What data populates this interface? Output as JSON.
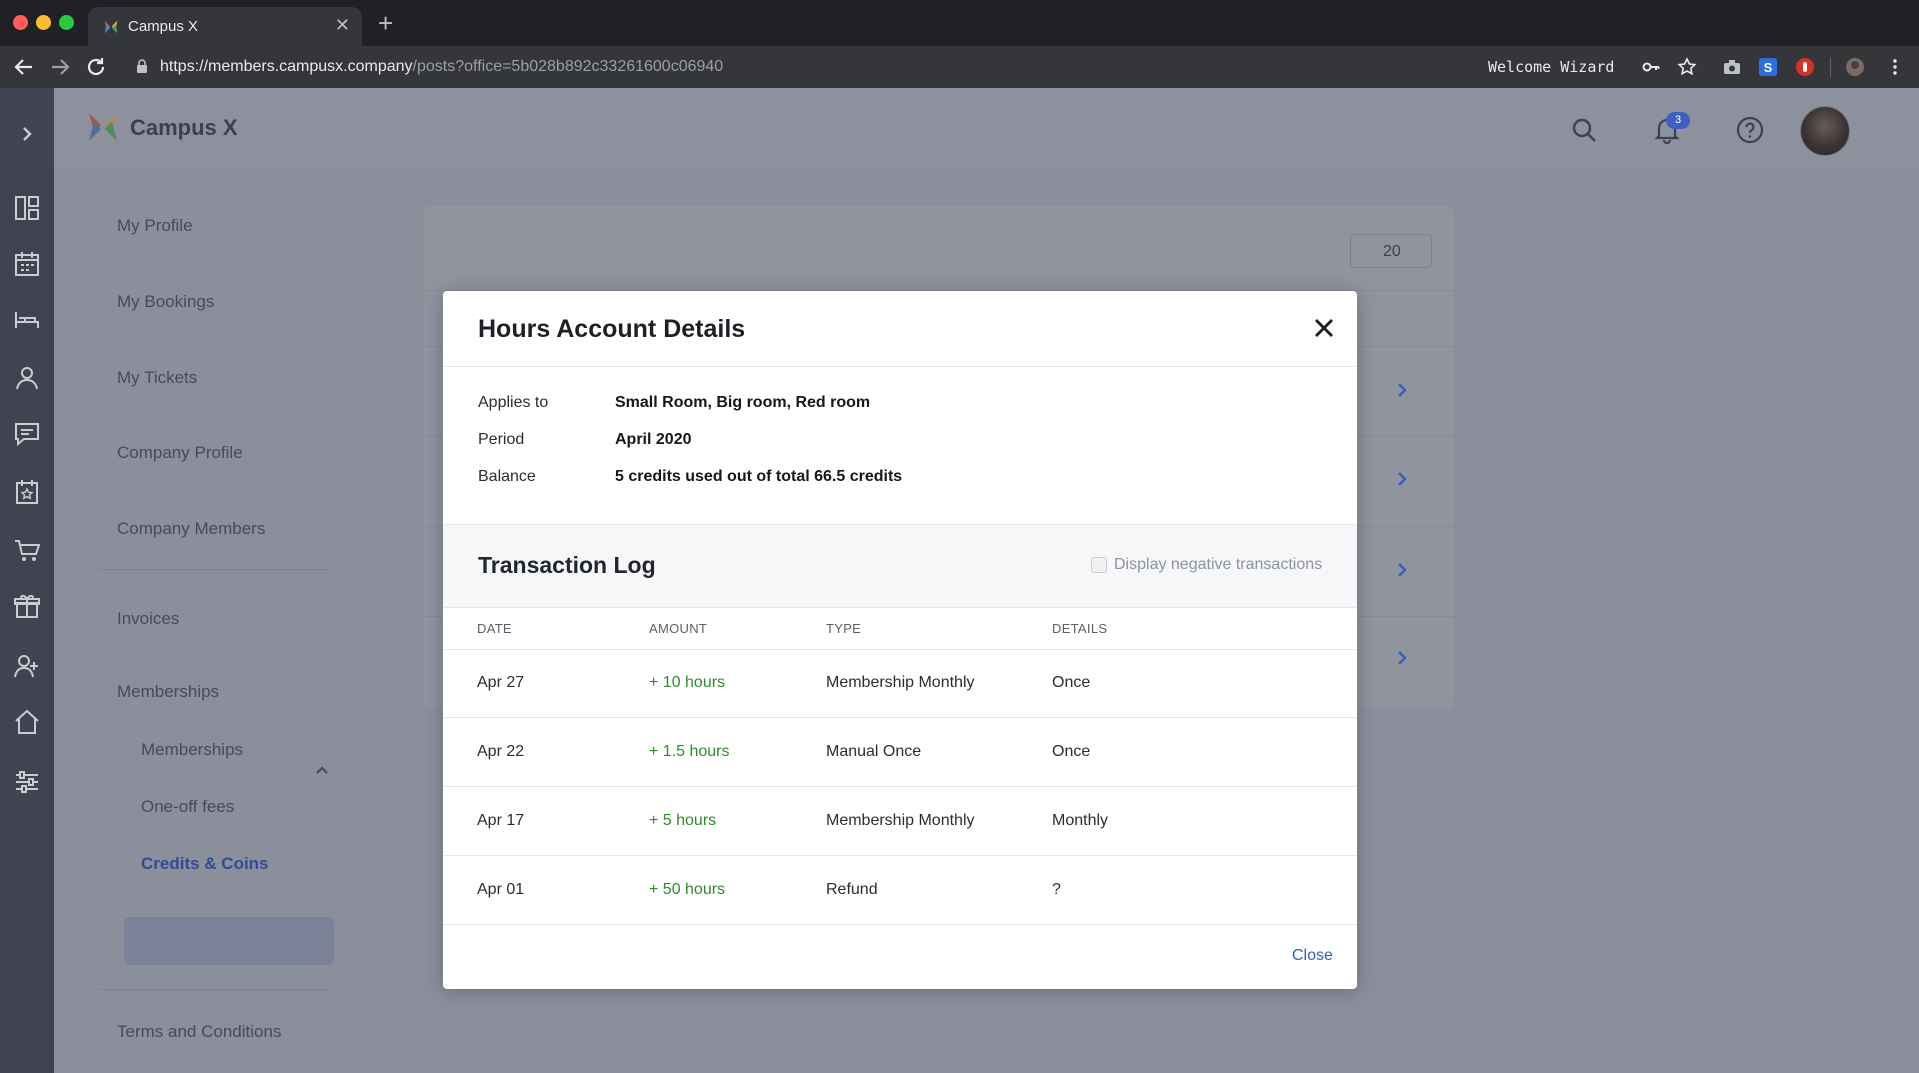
{
  "browser": {
    "tab_title": "Campus X",
    "url_host": "https://members.campusx.company",
    "url_path": "/posts?office=5b028b892c33261600c06940",
    "profile_name": "Welcome Wizard"
  },
  "app": {
    "brand": "Campus X",
    "notification_count": "3"
  },
  "sidebar": {
    "items": [
      {
        "label": "My Profile"
      },
      {
        "label": "My Bookings"
      },
      {
        "label": "My Tickets"
      },
      {
        "label": "Company Profile"
      },
      {
        "label": "Company Members"
      },
      {
        "label": "Invoices"
      },
      {
        "label": "Memberships"
      },
      {
        "label": "Terms and Conditions"
      }
    ],
    "sub_items": [
      {
        "label": "Memberships"
      },
      {
        "label": "One-off fees"
      },
      {
        "label": "Credits & Coins"
      }
    ]
  },
  "background_card": {
    "input_value_fragment": "20"
  },
  "modal": {
    "title": "Hours Account Details",
    "info": [
      {
        "label": "Applies to",
        "value": "Small Room, Big room, Red room"
      },
      {
        "label": "Period",
        "value": "April 2020"
      },
      {
        "label": "Balance",
        "value": "5 credits used out of total 66.5 credits"
      }
    ],
    "log": {
      "title": "Transaction Log",
      "negative_toggle_label": "Display negative transactions",
      "negative_toggle_checked": false,
      "columns": [
        "DATE",
        "AMOUNT",
        "TYPE",
        "DETAILS"
      ],
      "rows": [
        {
          "date": "Apr 27",
          "amount": "+ 10 hours",
          "type": "Membership Monthly",
          "details": "Once"
        },
        {
          "date": "Apr 22",
          "amount": "+ 1.5 hours",
          "type": "Manual Once",
          "details": "Once"
        },
        {
          "date": "Apr 17",
          "amount": "+ 5 hours",
          "type": "Membership Monthly",
          "details": "Monthly"
        },
        {
          "date": "Apr 01",
          "amount": "+ 50 hours",
          "type": "Refund",
          "details": "?"
        }
      ]
    },
    "close_label": "Close"
  },
  "colors": {
    "accent": "#2f5fc4",
    "positive_amount": "#2f8a2f",
    "overlay": "#8a8f9b"
  }
}
